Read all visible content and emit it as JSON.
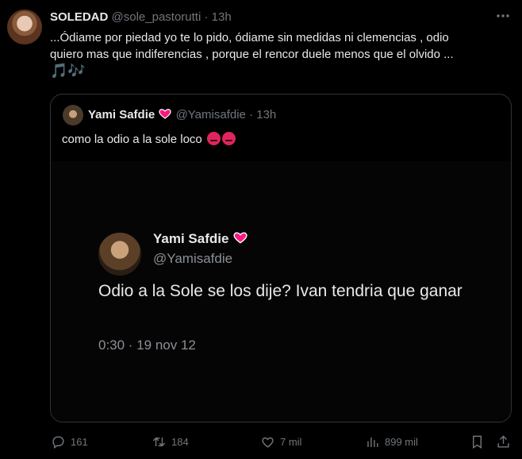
{
  "tweet": {
    "display_name": "SOLEDAD",
    "handle": "@sole_pastorutti",
    "separator": "·",
    "time": "13h",
    "more_icon": "more-horizontal-icon",
    "text_lines": [
      "...Ódiame por piedad yo te lo pido, ódiame sin medidas ni clemencias , odio",
      "quiero mas que indiferencias , porque el rencor duele menos que el olvido ..."
    ],
    "emoji_notes": "🎵🎶"
  },
  "quote": {
    "display_name": "Yami Safdie",
    "handle": "@Yamisafdie",
    "separator": "·",
    "time": "13h",
    "text": "como la odio a la sole loco",
    "emoji_icon": "angry-face-icon",
    "media": {
      "name": "Yami Safdie",
      "handle": "@Yamisafdie",
      "text": "Odio a la Sole se los dije? Ivan tendria que ganar",
      "timestamp": "0:30 · 19 nov 12"
    }
  },
  "actions": {
    "replies": "161",
    "retweets": "184",
    "likes": "7 mil",
    "views": "899 mil"
  },
  "colors": {
    "background": "#000000",
    "text": "#e7e9ea",
    "muted": "#71767b",
    "accent": "#1d9bf0",
    "heart": "#f91880"
  }
}
